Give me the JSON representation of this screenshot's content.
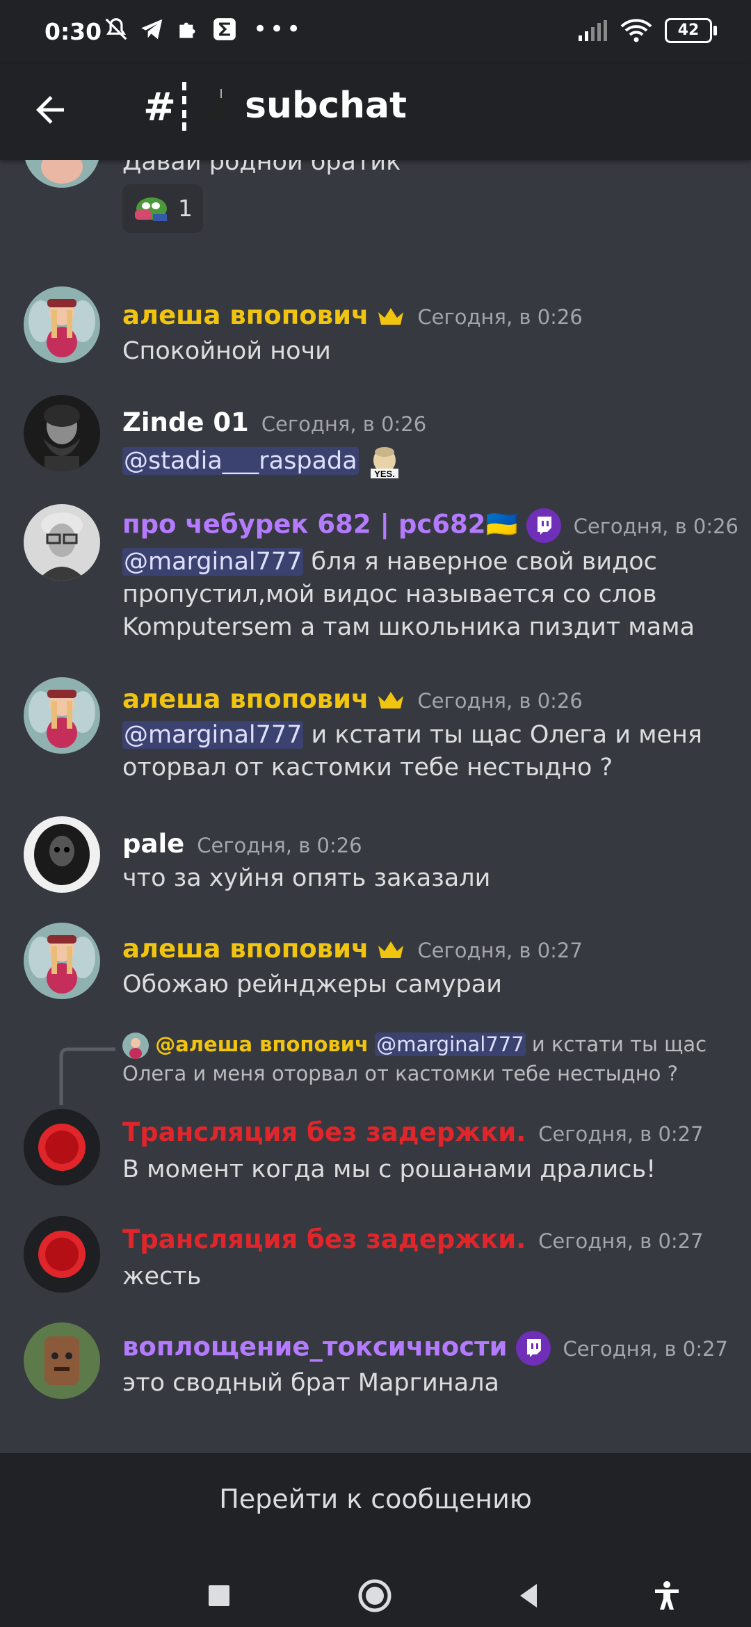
{
  "status_bar": {
    "time": "0:30",
    "battery": "42"
  },
  "header": {
    "hash": "#",
    "channel_name": "subchat"
  },
  "reaction": {
    "count": "1"
  },
  "messages": [
    {
      "id": "m0",
      "text": "Давай родной братик"
    },
    {
      "id": "m1",
      "author": "алеша впопович",
      "time": "Сегодня, в 0:26",
      "text": "Спокойной ночи"
    },
    {
      "id": "m2",
      "author": "Zinde 01",
      "time": "Сегодня, в 0:26",
      "mention": "@stadia___raspada"
    },
    {
      "id": "m3",
      "author": "про чебурек 682 | pc682🇺🇦",
      "time": "Сегодня, в 0:26",
      "mention": "@marginal777",
      "text": " бля я наверное свой видос пропустил,мой видос называется со слов Komputersem а там школьника пиздит мама"
    },
    {
      "id": "m4",
      "author": "алеша впопович",
      "time": "Сегодня, в 0:26",
      "mention": "@marginal777",
      "text": " и кстати ты щас Олега и меня оторвал от кастомки тебе нестыдно ?"
    },
    {
      "id": "m5",
      "author": "pale",
      "time": "Сегодня, в 0:26",
      "text": "что за хуйня опять заказали"
    },
    {
      "id": "m6",
      "author": "алеша впопович",
      "time": "Сегодня, в 0:27",
      "text": "Обожаю рейнджеры самураи"
    },
    {
      "id": "m7",
      "reply_author": "@алеша впопович",
      "reply_mention": "@marginal777",
      "reply_text_1": " и кстати ты щас",
      "reply_text_2": "Олега и меня оторвал от кастомки тебе нестыдно ?",
      "author": "Трансляция без задержки.",
      "time": "Сегодня, в 0:27",
      "text": "В момент когда мы с рошанами дрались!"
    },
    {
      "id": "m8",
      "author": "Трансляция без задержки.",
      "time": "Сегодня, в 0:27",
      "text": "жесть"
    },
    {
      "id": "m9",
      "author": "воплощение_токсичности",
      "time": "Сегодня, в 0:27",
      "text": "это сводный брат Маргинала"
    }
  ],
  "bottom": {
    "jump_label": "Перейти к сообщению"
  },
  "colors": {
    "background": "#36393f",
    "header": "#202225",
    "gold_name": "#f1c40f",
    "purple_name": "#b57bff",
    "red_name": "#e0262b",
    "white_name": "#ffffff",
    "timestamp": "#a3a6aa",
    "mention_bg": "#3c4270"
  },
  "icons": [
    "back-arrow-icon",
    "crown-icon",
    "twitch-icon",
    "spider-icon",
    "home-icon",
    "recents-icon",
    "back-icon",
    "accessibility-icon"
  ]
}
